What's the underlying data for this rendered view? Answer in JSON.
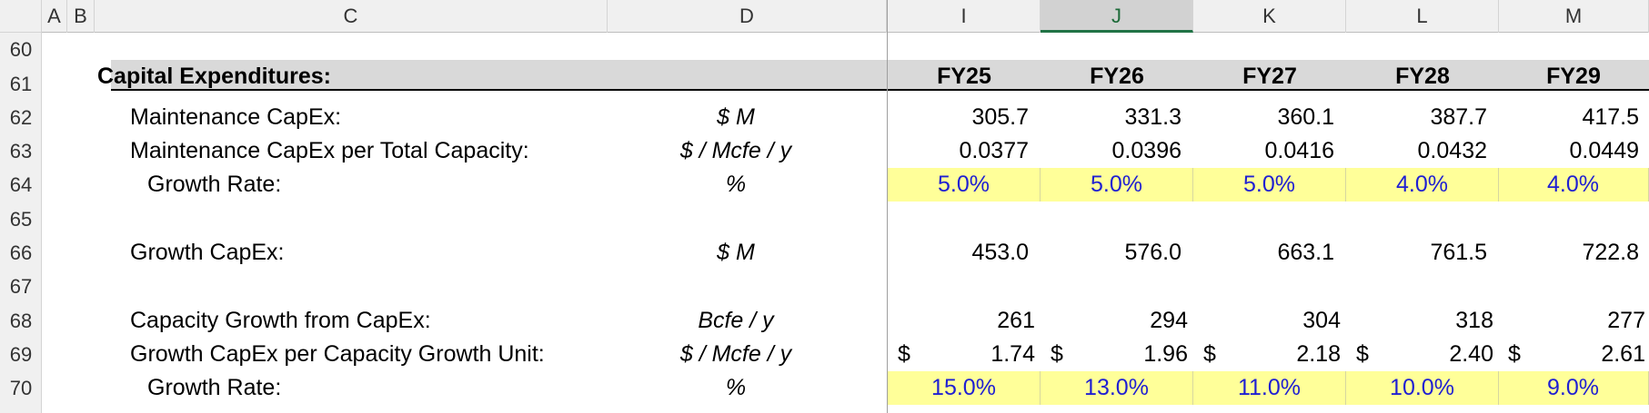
{
  "columns": [
    "A",
    "B",
    "C",
    "D",
    "I",
    "J",
    "K",
    "L",
    "M"
  ],
  "selected_column": "J",
  "row_numbers": [
    "60",
    "61",
    "62",
    "63",
    "64",
    "65",
    "66",
    "67",
    "68",
    "69",
    "70"
  ],
  "section_title": "Capital Expenditures:",
  "years": [
    "FY25",
    "FY26",
    "FY27",
    "FY28",
    "FY29"
  ],
  "rows": {
    "maint_capex": {
      "label": "Maintenance CapEx:",
      "unit": "$ M",
      "values": [
        "305.7",
        "331.3",
        "360.1",
        "387.7",
        "417.5"
      ]
    },
    "maint_per_cap": {
      "label": "Maintenance CapEx per Total Capacity:",
      "unit": "$ / Mcfe / y",
      "values": [
        "0.0377",
        "0.0396",
        "0.0416",
        "0.0432",
        "0.0449"
      ]
    },
    "maint_growth": {
      "label": "Growth Rate:",
      "unit": "%",
      "values": [
        "5.0%",
        "5.0%",
        "5.0%",
        "4.0%",
        "4.0%"
      ]
    },
    "growth_capex": {
      "label": "Growth CapEx:",
      "unit": "$ M",
      "values": [
        "453.0",
        "576.0",
        "663.1",
        "761.5",
        "722.8"
      ]
    },
    "cap_growth": {
      "label": "Capacity Growth from CapEx:",
      "unit": "Bcfe / y",
      "values": [
        "261",
        "294",
        "304",
        "318",
        "277"
      ]
    },
    "growth_per_unit": {
      "label": "Growth CapEx per Capacity Growth Unit:",
      "unit": "$ / Mcfe / y",
      "currency": "$",
      "values": [
        "1.74",
        "1.96",
        "2.18",
        "2.40",
        "2.61"
      ]
    },
    "growth_rate2": {
      "label": "Growth Rate:",
      "unit": "%",
      "values": [
        "15.0%",
        "13.0%",
        "11.0%",
        "10.0%",
        "9.0%"
      ]
    }
  },
  "colors": {
    "input_text": "#1f1fd2",
    "input_fill": "#ffff99",
    "header_band": "#d9d9d9",
    "selected_header": "#217346"
  }
}
